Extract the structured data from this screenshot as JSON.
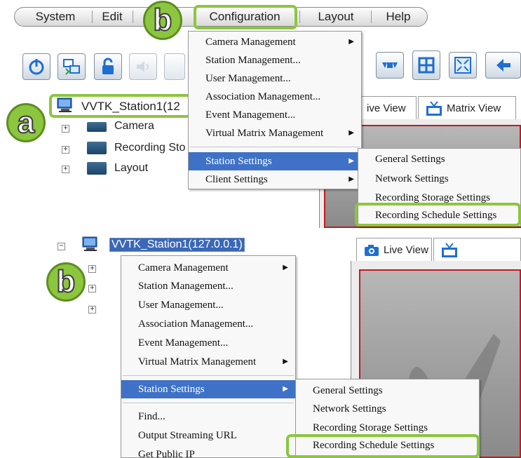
{
  "menubar": {
    "items": [
      "System",
      "Edit",
      "Configuration",
      "Layout",
      "Help"
    ]
  },
  "badges": {
    "a": "a",
    "b_top": "b",
    "b_bottom": "b"
  },
  "tree": {
    "station_top": "VVTK_Station1(12",
    "items": [
      "Camera",
      "Recording Sto",
      "Layout"
    ],
    "station_bottom": "VVTK_Station1(127.0.0.1)"
  },
  "tabs": {
    "live_view_partial": "ive View",
    "matrix_view": "Matrix View",
    "live_view": "Live View"
  },
  "config_menu": {
    "items": [
      {
        "label": "Camera Management",
        "submenu": true
      },
      {
        "label": "Station Management...",
        "submenu": false
      },
      {
        "label": "User Management...",
        "submenu": false
      },
      {
        "label": "Association Management...",
        "submenu": false
      },
      {
        "label": "Event Management...",
        "submenu": false
      },
      {
        "label": "Virtual Matrix Management",
        "submenu": true
      },
      {
        "label": "Station Settings",
        "submenu": true,
        "selected": true
      },
      {
        "label": "Client Settings",
        "submenu": true
      }
    ]
  },
  "station_submenu": {
    "items": [
      "General Settings",
      "Network Settings",
      "Recording Storage Settings",
      "Recording Schedule Settings"
    ]
  },
  "context_menu": {
    "items": [
      {
        "label": "Camera Management",
        "submenu": true
      },
      {
        "label": "Station Management...",
        "submenu": false
      },
      {
        "label": "User Management...",
        "submenu": false
      },
      {
        "label": "Association Management...",
        "submenu": false
      },
      {
        "label": "Event Management...",
        "submenu": false
      },
      {
        "label": "Virtual Matrix Management",
        "submenu": true
      },
      {
        "label": "Station Settings",
        "submenu": true,
        "selected": true
      },
      {
        "label": "Find...",
        "submenu": false
      },
      {
        "label": "Output Streaming URL",
        "submenu": false
      },
      {
        "label": "Get Public IP",
        "submenu": false
      }
    ]
  },
  "station_submenu_bottom": {
    "items": [
      "General Settings",
      "Network Settings",
      "Recording Storage Settings",
      "Recording Schedule Settings"
    ]
  },
  "colors": {
    "highlight_green": "#8cc63f",
    "menu_selection": "#3f72c6",
    "view_border": "#c7171f"
  }
}
